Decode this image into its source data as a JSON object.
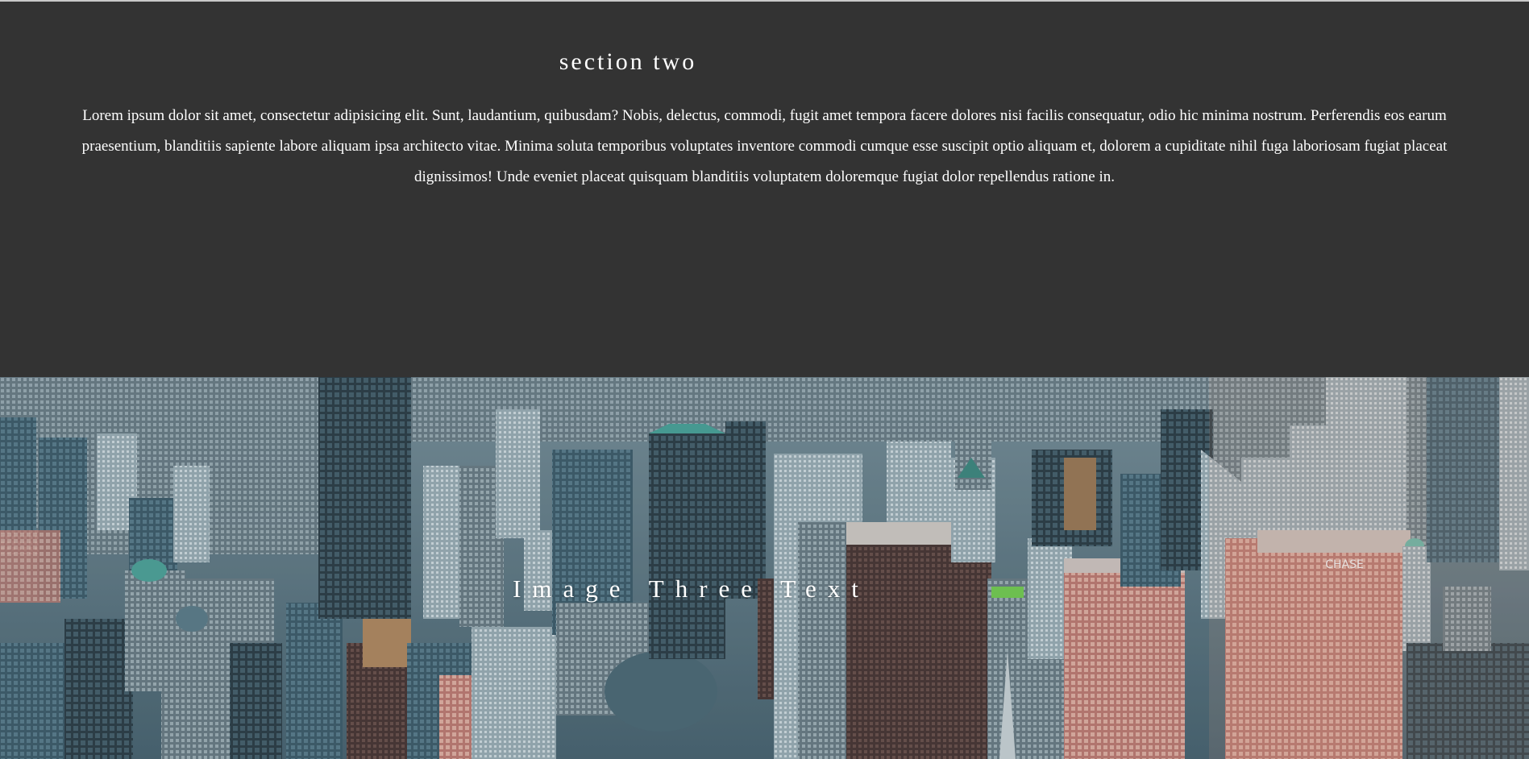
{
  "section_two": {
    "title": "section two",
    "body": "Lorem ipsum dolor sit amet, consectetur adipisicing elit. Sunt, laudantium, quibusdam? Nobis, delectus, commodi, fugit amet tempora facere dolores nisi facilis consequatur, odio hic minima nostrum. Perferendis eos earum praesentium, blanditiis sapiente labore aliquam ipsa architecto vitae. Minima soluta temporibus voluptates inventore commodi cumque esse suscipit optio aliquam et, dolorem a cupiditate nihil fuga laboriosam fugiat placeat dignissimos! Unde eveniet placeat quisquam blanditiis voluptatem doloremque fugiat dolor repellendus ratione in."
  },
  "image_section": {
    "caption": "Image Three Text",
    "sign_text": "CHASE"
  },
  "colors": {
    "section_bg": "#333333",
    "text": "#ffffff"
  }
}
